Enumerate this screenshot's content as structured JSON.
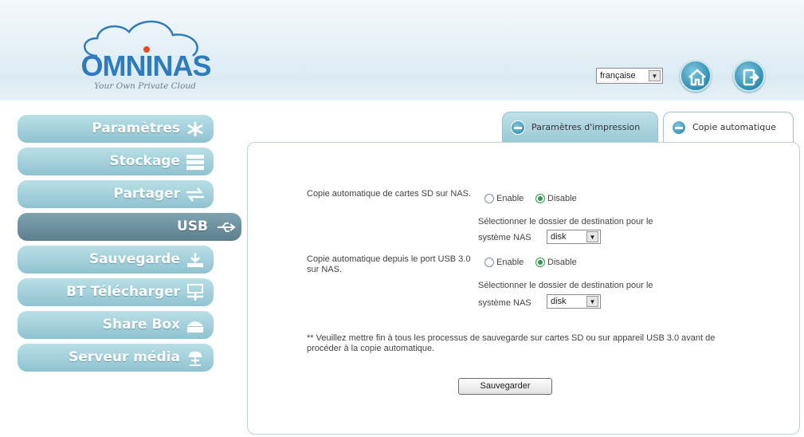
{
  "header": {
    "logo_word": "OMNINAS",
    "tagline": "Your Own Private Cloud",
    "language": "française",
    "home_icon": "home-icon",
    "logout_icon": "logout-icon"
  },
  "sidebar": {
    "items": [
      {
        "label": "Paramètres",
        "icon": "settings-icon"
      },
      {
        "label": "Stockage",
        "icon": "storage-icon"
      },
      {
        "label": "Partager",
        "icon": "share-icon"
      },
      {
        "label": "USB",
        "icon": "usb-icon",
        "active": true
      },
      {
        "label": "Sauvegarde",
        "icon": "backup-icon"
      },
      {
        "label": "BT Télécharger",
        "icon": "bt-download-icon"
      },
      {
        "label": "Share Box",
        "icon": "share-box-icon"
      },
      {
        "label": "Serveur média",
        "icon": "media-server-icon"
      }
    ]
  },
  "tabs": [
    {
      "label": "Paramètres d'impression",
      "active": false
    },
    {
      "label": "Copie automatique",
      "active": true
    }
  ],
  "form": {
    "sd_copy": {
      "label": "Copie automatique de cartes SD sur NAS.",
      "enable": "Enable",
      "disable": "Disable",
      "selected": "Disable",
      "dest_text": "Sélectionner le dossier de destination pour le",
      "dest_label": "système NAS",
      "dest_value": "disk"
    },
    "usb_copy": {
      "label": "Copie automatique depuis le port USB 3.0 sur NAS.",
      "enable": "Enable",
      "disable": "Disable",
      "selected": "Disable",
      "dest_text": "Sélectionner le dossier de destination pour le",
      "dest_label": "système NAS",
      "dest_value": "disk"
    },
    "note": "** Veuillez mettre fin à tous les processus de sauvegarde sur cartes SD ou sur appareil USB 3.0 avant de procéder à la copie automatique.",
    "save_label": "Sauvegarder"
  },
  "colors": {
    "accent": "#2f8db1",
    "nav": "#9fcfdb",
    "nav_active": "#6c8f9c",
    "radio_checked": "#2f9b4b"
  }
}
